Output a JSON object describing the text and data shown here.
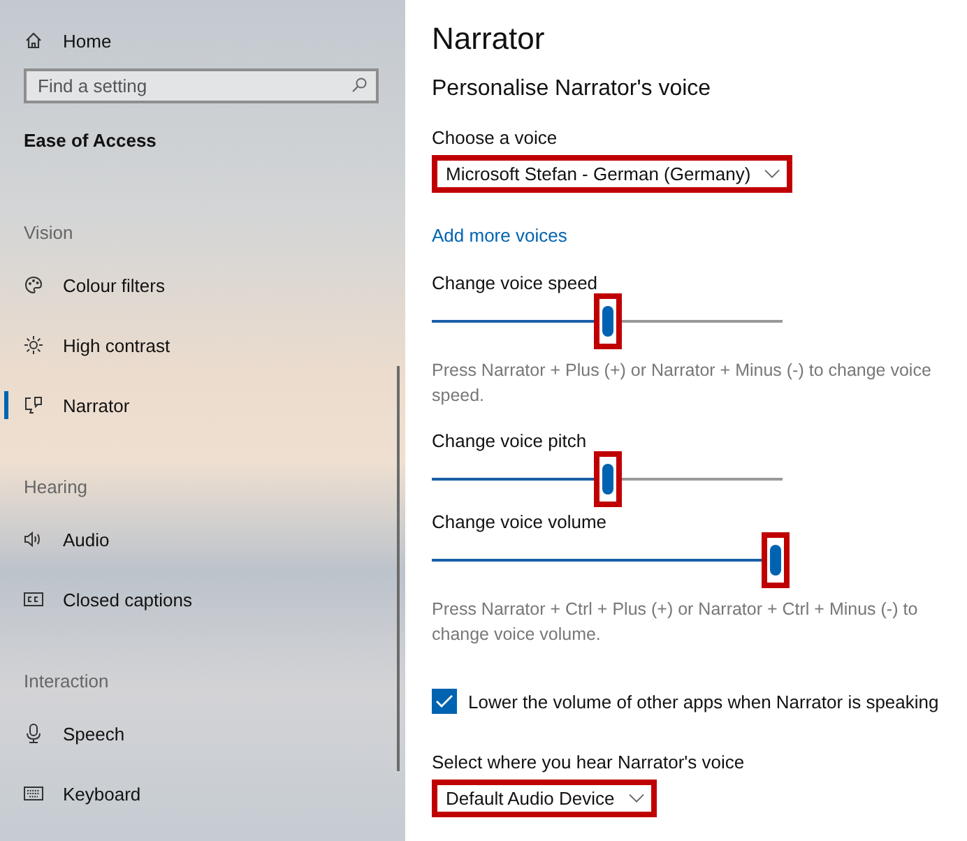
{
  "sidebar": {
    "home": "Home",
    "search": {
      "placeholder": "Find a setting"
    },
    "section_title": "Ease of Access",
    "groups": [
      {
        "heading": "Vision",
        "items": [
          {
            "label": "Colour filters",
            "selected": false
          },
          {
            "label": "High contrast",
            "selected": false
          },
          {
            "label": "Narrator",
            "selected": true
          }
        ]
      },
      {
        "heading": "Hearing",
        "items": [
          {
            "label": "Audio",
            "selected": false
          },
          {
            "label": "Closed captions",
            "selected": false
          }
        ]
      },
      {
        "heading": "Interaction",
        "items": [
          {
            "label": "Speech",
            "selected": false
          },
          {
            "label": "Keyboard",
            "selected": false
          }
        ]
      }
    ]
  },
  "main": {
    "title": "Narrator",
    "subtitle": "Personalise Narrator's voice",
    "voice": {
      "label": "Choose a voice",
      "value": "Microsoft Stefan - German (Germany)",
      "highlighted": true
    },
    "add_link": "Add more voices",
    "speed": {
      "label": "Change voice speed",
      "level": 0.5,
      "highlighted": true,
      "hint": "Press Narrator + Plus (+) or Narrator + Minus (-) to change voice speed."
    },
    "pitch": {
      "label": "Change voice pitch",
      "level": 0.5,
      "highlighted": true
    },
    "volume": {
      "label": "Change voice volume",
      "level": 0.98,
      "highlighted": true,
      "hint": "Press Narrator + Ctrl + Plus (+) or Narrator + Ctrl + Minus (-) to change voice volume."
    },
    "lower_volume": {
      "label": "Lower the volume of other apps when Narrator is speaking",
      "checked": true
    },
    "output": {
      "label": "Select where you hear Narrator's voice",
      "value": "Default Audio Device",
      "highlighted": true
    }
  }
}
